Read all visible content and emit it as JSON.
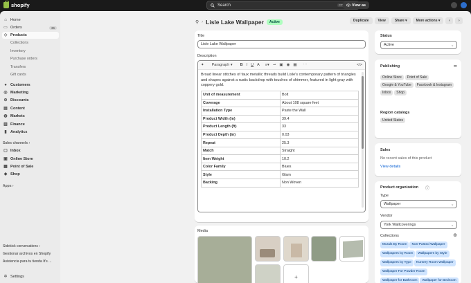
{
  "topbar": {
    "logo": "shopify",
    "search_placeholder": "Search",
    "shortcut": "CTRL",
    "shortcut_key": "K",
    "view_as": "View as"
  },
  "sidebar": {
    "home": "Home",
    "orders": "Orders",
    "orders_count": "36",
    "products": "Products",
    "collections": "Collections",
    "inventory": "Inventory",
    "purchase_orders": "Purchase orders",
    "transfers": "Transfers",
    "gift_cards": "Gift cards",
    "customers": "Customers",
    "marketing": "Marketing",
    "discounts": "Discounts",
    "content": "Content",
    "markets": "Markets",
    "finance": "Finance",
    "analytics": "Analytics",
    "sales_channels": "Sales channels",
    "inbox": "Inbox",
    "online_store": "Online Store",
    "point_of_sale": "Point of Sale",
    "shop": "Shop",
    "apps": "Apps",
    "sidekick": "Sidekick conversations",
    "sidekick_1": "Gestionar archivos en Shopify",
    "sidekick_2": "Asistencia para tu tienda It's ...",
    "settings": "Settings"
  },
  "header": {
    "title": "Lisle Lake Wallpaper",
    "status_badge": "Active",
    "duplicate": "Duplicate",
    "view": "View",
    "share": "Share",
    "more_actions": "More actions"
  },
  "product": {
    "title_label": "Title",
    "title_value": "Lisle Lake Wallpaper",
    "description_label": "Description",
    "paragraph": "Paragraph",
    "description": "Broad linear stitches of faux metallic threads build Lisle's contemporary pattern of triangles and shapes against a rustic backdrop with touches of shimmer, featured in light gray with coppery gold.",
    "specs": [
      [
        "Unit of measurement",
        "Bolt"
      ],
      [
        "Coverage",
        "About 108 square feet"
      ],
      [
        "Installation Type",
        "Paste the Wall"
      ],
      [
        "Product Width (in)",
        "39.4"
      ],
      [
        "Product Length (ft)",
        "33"
      ],
      [
        "Product Depth (in)",
        "0.03"
      ],
      [
        "Repeat",
        "25.3"
      ],
      [
        "Match",
        "Straight"
      ],
      [
        "Item Weight",
        "10.2"
      ],
      [
        "Color Family",
        "Blues"
      ],
      [
        "Style",
        "Glam"
      ],
      [
        "Backing",
        "Non Woven"
      ]
    ],
    "media_label": "Media",
    "add_media": "+"
  },
  "right": {
    "status_label": "Status",
    "status_value": "Active",
    "publishing_label": "Publishing",
    "channels": [
      "Online Store",
      "Point of Sale",
      "Google & YouTube",
      "Facebook & Instagram",
      "Inbox",
      "Shop"
    ],
    "region_label": "Region catalogs",
    "region_value": "United States",
    "sales_label": "Sales",
    "sales_text": "No recent sales of this product",
    "view_details": "View details",
    "org_label": "Product organization",
    "type_label": "Type",
    "type_value": "Wallpaper",
    "vendor_label": "Vendor",
    "vendor_value": "York Wallcoverings",
    "collections_label": "Collections",
    "collections": [
      "Murals By Room",
      "Non-Pasted Wallpaper",
      "Wallpapers by Room",
      "Wallpapers by Style",
      "Wallpapers by Type",
      "Nursery Room Wallpaper",
      "Wallpaper For Powder Room",
      "Wallpaper for Bathroom",
      "Wallpaper for Bedroom",
      "Best selling products (DO NOT DELETE)"
    ]
  },
  "colors": {
    "accent": "#005bd3",
    "active_badge": "#affebf",
    "sidebar_bg": "#ebebeb",
    "topbar_bg": "#1a1a1a"
  }
}
